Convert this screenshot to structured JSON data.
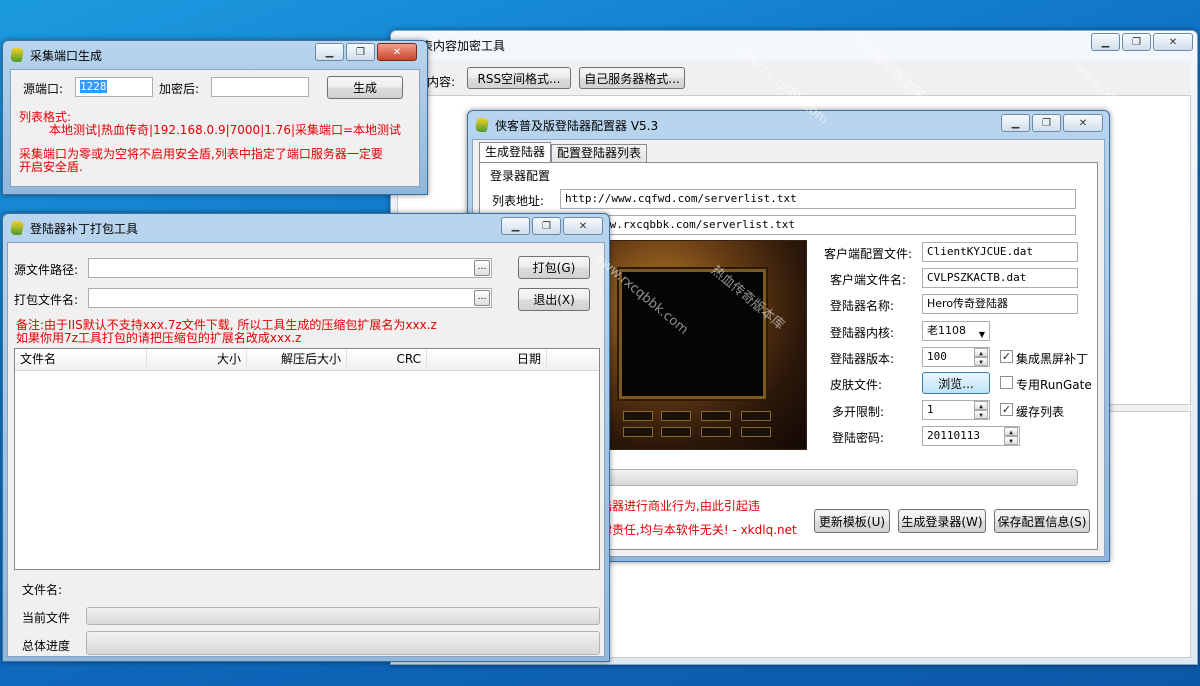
{
  "bg_window": {
    "title": "表内容加密工具",
    "label_content": "内容:",
    "btn_rss": "RSS空间格式...",
    "btn_own": "自己服务器格式..."
  },
  "collect_window": {
    "title": "采集端口生成",
    "src_port_label": "源端口:",
    "src_port_value": "1228",
    "encrypted_label": "加密后:",
    "encrypted_value": "",
    "generate_button": "生成",
    "list_format_label": "列表格式:",
    "list_format_example": "本地测试|热血传奇|192.168.0.9|7000|1.76|采集端口=本地测试",
    "note_line1": "采集端口为零或为空将不启用安全盾,列表中指定了端口服务器一定要",
    "note_line2": "开启安全盾."
  },
  "config_window": {
    "title": "侠客普及版登陆器配置器 V5.3",
    "tab_generate": "生成登陆器",
    "tab_config_list": "配置登陆器列表",
    "group_title": "登录器配置",
    "list_addr_label": "列表地址:",
    "list_addr_value": "http://www.cqfwd.com/serverlist.txt",
    "backup_addr_value": "ww.rxcqbbk.com/serverlist.txt",
    "client_config_label": "客户端配置文件:",
    "client_config_value": "ClientKYJCUE.dat",
    "client_file_label": "客户端文件名:",
    "client_file_value": "CVLPSZKACTB.dat",
    "login_name_label": "登陆器名称:",
    "login_name_value": "Hero传奇登陆器",
    "kernel_label": "登陆器内核:",
    "kernel_value": "老1108",
    "version_label": "登陆器版本:",
    "version_value": "100",
    "black_screen_patch": "集成黑屏补丁",
    "skin_label": "皮肤文件:",
    "browse_button": "浏览...",
    "runGate_label": "专用RunGate",
    "multi_label": "多开限制:",
    "multi_value": "1",
    "cache_list_label": "缓存列表",
    "password_label": "登陆密码:",
    "password_value": "20110113",
    "warn_line1": "陆器进行商业行为,由此引起违",
    "warn_line2": "律责任,均与本软件无关! - xkdlq.net",
    "btn_update_template": "更新模板(U)",
    "btn_generate": "生成登录器(W)",
    "btn_save": "保存配置信息(S)"
  },
  "patch_window": {
    "title": "登陆器补丁打包工具",
    "src_path_label": "源文件路径:",
    "pack_name_label": "打包文件名:",
    "btn_pack": "打包(G)",
    "btn_exit": "退出(X)",
    "note_line1": "备注:由于IIS默认不支持xxx.7z文件下载, 所以工具生成的压缩包扩展名为xxx.z",
    "note_line2": "如果你用7z工具打包的请把压缩包的扩展名改成xxx.z",
    "columns": [
      "文件名",
      "大小",
      "解压后大小",
      "CRC",
      "日期"
    ],
    "file_name_label": "文件名:",
    "current_file_label": "当前文件",
    "total_progress_label": "总体进度"
  },
  "watermark": "www.rxcqbbk.com",
  "watermark_cn": "热血传奇版本库"
}
